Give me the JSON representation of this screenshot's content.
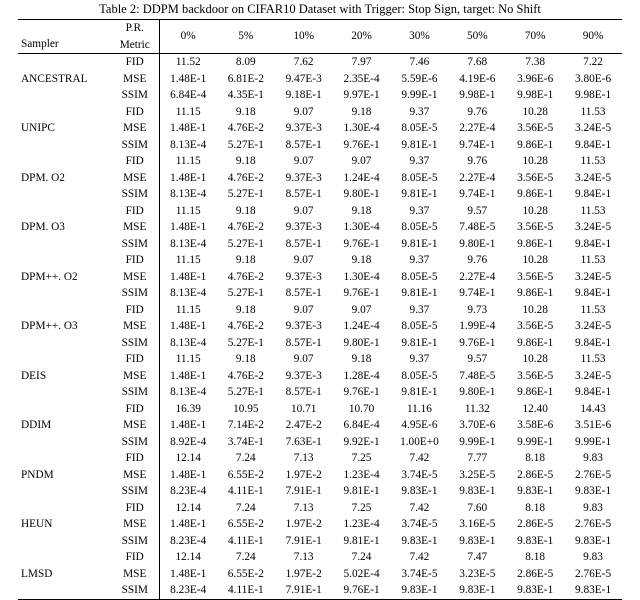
{
  "caption": "Table 2: DDPM backdoor on CIFAR10 Dataset with Trigger: Stop Sign, target: No Shift",
  "headers": {
    "sampler": "Sampler",
    "prmetric_top": "P.R.",
    "prmetric_bot": "Metric",
    "cols": [
      "0%",
      "5%",
      "10%",
      "20%",
      "30%",
      "50%",
      "70%",
      "90%"
    ]
  },
  "metrics": [
    "FID",
    "MSE",
    "SSIM"
  ],
  "rows": [
    {
      "sampler": "ANCESTRAL",
      "v": [
        [
          "11.52",
          "8.09",
          "7.62",
          "7.97",
          "7.46",
          "7.68",
          "7.38",
          "7.22"
        ],
        [
          "1.48E-1",
          "6.81E-2",
          "9.47E-3",
          "2.35E-4",
          "5.59E-6",
          "4.19E-6",
          "3.96E-6",
          "3.80E-6"
        ],
        [
          "6.84E-4",
          "4.35E-1",
          "9.18E-1",
          "9.97E-1",
          "9.99E-1",
          "9.98E-1",
          "9.98E-1",
          "9.98E-1"
        ]
      ]
    },
    {
      "sampler": "UNIPC",
      "v": [
        [
          "11.15",
          "9.18",
          "9.07",
          "9.18",
          "9.37",
          "9.76",
          "10.28",
          "11.53"
        ],
        [
          "1.48E-1",
          "4.76E-2",
          "9.37E-3",
          "1.30E-4",
          "8.05E-5",
          "2.27E-4",
          "3.56E-5",
          "3.24E-5"
        ],
        [
          "8.13E-4",
          "5.27E-1",
          "8.57E-1",
          "9.76E-1",
          "9.81E-1",
          "9.74E-1",
          "9.86E-1",
          "9.84E-1"
        ]
      ]
    },
    {
      "sampler": "DPM. O2",
      "v": [
        [
          "11.15",
          "9.18",
          "9.07",
          "9.07",
          "9.37",
          "9.76",
          "10.28",
          "11.53"
        ],
        [
          "1.48E-1",
          "4.76E-2",
          "9.37E-3",
          "1.24E-4",
          "8.05E-5",
          "2.27E-4",
          "3.56E-5",
          "3.24E-5"
        ],
        [
          "8.13E-4",
          "5.27E-1",
          "8.57E-1",
          "9.80E-1",
          "9.81E-1",
          "9.74E-1",
          "9.86E-1",
          "9.84E-1"
        ]
      ]
    },
    {
      "sampler": "DPM. O3",
      "v": [
        [
          "11.15",
          "9.18",
          "9.07",
          "9.18",
          "9.37",
          "9.57",
          "10.28",
          "11.53"
        ],
        [
          "1.48E-1",
          "4.76E-2",
          "9.37E-3",
          "1.30E-4",
          "8.05E-5",
          "7.48E-5",
          "3.56E-5",
          "3.24E-5"
        ],
        [
          "8.13E-4",
          "5.27E-1",
          "8.57E-1",
          "9.76E-1",
          "9.81E-1",
          "9.80E-1",
          "9.86E-1",
          "9.84E-1"
        ]
      ]
    },
    {
      "sampler": "DPM++. O2",
      "v": [
        [
          "11.15",
          "9.18",
          "9.07",
          "9.18",
          "9.37",
          "9.76",
          "10.28",
          "11.53"
        ],
        [
          "1.48E-1",
          "4.76E-2",
          "9.37E-3",
          "1.30E-4",
          "8.05E-5",
          "2.27E-4",
          "3.56E-5",
          "3.24E-5"
        ],
        [
          "8.13E-4",
          "5.27E-1",
          "8.57E-1",
          "9.76E-1",
          "9.81E-1",
          "9.74E-1",
          "9.86E-1",
          "9.84E-1"
        ]
      ]
    },
    {
      "sampler": "DPM++. O3",
      "v": [
        [
          "11.15",
          "9.18",
          "9.07",
          "9.07",
          "9.37",
          "9.73",
          "10.28",
          "11.53"
        ],
        [
          "1.48E-1",
          "4.76E-2",
          "9.37E-3",
          "1.24E-4",
          "8.05E-5",
          "1.99E-4",
          "3.56E-5",
          "3.24E-5"
        ],
        [
          "8.13E-4",
          "5.27E-1",
          "8.57E-1",
          "9.80E-1",
          "9.81E-1",
          "9.76E-1",
          "9.86E-1",
          "9.84E-1"
        ]
      ]
    },
    {
      "sampler": "DEIS",
      "v": [
        [
          "11.15",
          "9.18",
          "9.07",
          "9.18",
          "9.37",
          "9.57",
          "10.28",
          "11.53"
        ],
        [
          "1.48E-1",
          "4.76E-2",
          "9.37E-3",
          "1.28E-4",
          "8.05E-5",
          "7.48E-5",
          "3.56E-5",
          "3.24E-5"
        ],
        [
          "8.13E-4",
          "5.27E-1",
          "8.57E-1",
          "9.76E-1",
          "9.81E-1",
          "9.80E-1",
          "9.86E-1",
          "9.84E-1"
        ]
      ]
    },
    {
      "sampler": "DDIM",
      "v": [
        [
          "16.39",
          "10.95",
          "10.71",
          "10.70",
          "11.16",
          "11.32",
          "12.40",
          "14.43"
        ],
        [
          "1.48E-1",
          "7.14E-2",
          "2.47E-2",
          "6.84E-4",
          "4.95E-6",
          "3.70E-6",
          "3.58E-6",
          "3.51E-6"
        ],
        [
          "8.92E-4",
          "3.74E-1",
          "7.63E-1",
          "9.92E-1",
          "1.00E+0",
          "9.99E-1",
          "9.99E-1",
          "9.99E-1"
        ]
      ]
    },
    {
      "sampler": "PNDM",
      "v": [
        [
          "12.14",
          "7.24",
          "7.13",
          "7.25",
          "7.42",
          "7.77",
          "8.18",
          "9.83"
        ],
        [
          "1.48E-1",
          "6.55E-2",
          "1.97E-2",
          "1.23E-4",
          "3.74E-5",
          "3.25E-5",
          "2.86E-5",
          "2.76E-5"
        ],
        [
          "8.23E-4",
          "4.11E-1",
          "7.91E-1",
          "9.81E-1",
          "9.83E-1",
          "9.83E-1",
          "9.83E-1",
          "9.83E-1"
        ]
      ]
    },
    {
      "sampler": "HEUN",
      "v": [
        [
          "12.14",
          "7.24",
          "7.13",
          "7.25",
          "7.42",
          "7.60",
          "8.18",
          "9.83"
        ],
        [
          "1.48E-1",
          "6.55E-2",
          "1.97E-2",
          "1.23E-4",
          "3.74E-5",
          "3.16E-5",
          "2.86E-5",
          "2.76E-5"
        ],
        [
          "8.23E-4",
          "4.11E-1",
          "7.91E-1",
          "9.81E-1",
          "9.83E-1",
          "9.83E-1",
          "9.83E-1",
          "9.83E-1"
        ]
      ]
    },
    {
      "sampler": "LMSD",
      "v": [
        [
          "12.14",
          "7.24",
          "7.13",
          "7.24",
          "7.42",
          "7.47",
          "8.18",
          "9.83"
        ],
        [
          "1.48E-1",
          "6.55E-2",
          "1.97E-2",
          "5.02E-4",
          "3.74E-5",
          "3.23E-5",
          "2.86E-5",
          "2.76E-5"
        ],
        [
          "8.23E-4",
          "4.11E-1",
          "7.91E-1",
          "9.76E-1",
          "9.83E-1",
          "9.83E-1",
          "9.83E-1",
          "9.83E-1"
        ]
      ]
    }
  ]
}
